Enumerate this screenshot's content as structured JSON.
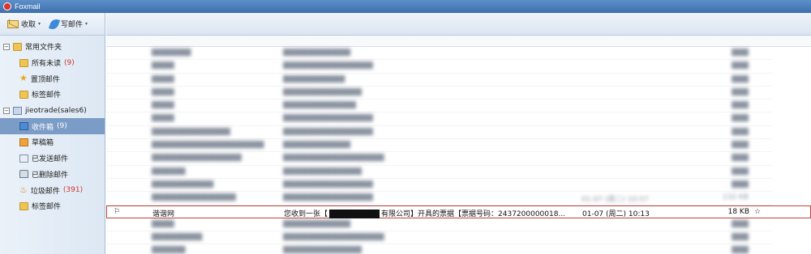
{
  "app": {
    "title": "Foxmail"
  },
  "toolbar": {
    "receive_label": "收取",
    "compose_label": "写邮件",
    "caret": "▾"
  },
  "sidebar": {
    "groups": [
      {
        "label": "常用文件夹",
        "items": [
          {
            "label": "所有未读",
            "count": "(9)",
            "icon": "folder-icon"
          },
          {
            "label": "置顶邮件",
            "count": "",
            "icon": "star-icon"
          },
          {
            "label": "标签邮件",
            "count": "",
            "icon": "folder-icon"
          }
        ]
      },
      {
        "label": "jieotrade(sales6)",
        "items": [
          {
            "label": "收件箱",
            "count": "(9)",
            "icon": "inbox-icon",
            "selected": true
          },
          {
            "label": "草稿箱",
            "count": "",
            "icon": "draft-icon"
          },
          {
            "label": "已发送邮件",
            "count": "",
            "icon": "sent-icon"
          },
          {
            "label": "已删除邮件",
            "count": "",
            "icon": "trash-icon"
          },
          {
            "label": "垃圾邮件",
            "count": "(391)",
            "icon": "junk-icon"
          },
          {
            "label": "标签邮件",
            "count": "",
            "icon": "folder-icon"
          }
        ]
      }
    ]
  },
  "messages": {
    "blurred_rows": [
      {
        "from": "……",
        "subject": "……………………",
        "date": "01-07 (周二) 10:57",
        "size": "132 KB"
      }
    ],
    "highlighted": {
      "from": "谐谐网",
      "subject_prefix": "您收到一张【",
      "subject_suffix": "有限公司】开具的票据【票据号码：2437200000018...",
      "date": "01-07 (周二) 10:13",
      "size": "18 KB"
    }
  },
  "colors": {
    "highlight_border": "#c0433c",
    "selected_bg": "#7b9cc7",
    "count_red": "#d0342c"
  }
}
